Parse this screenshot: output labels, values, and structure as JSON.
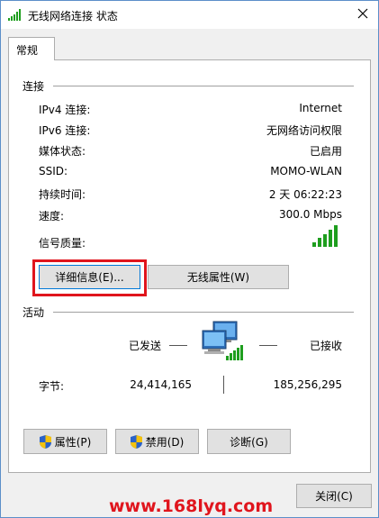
{
  "window": {
    "title": "无线网络连接 状态"
  },
  "tabs": [
    {
      "label": "常规"
    }
  ],
  "connection": {
    "header": "连接",
    "rows": [
      {
        "label": "IPv4 连接:",
        "value": "Internet"
      },
      {
        "label": "IPv6 连接:",
        "value": "无网络访问权限"
      },
      {
        "label": "媒体状态:",
        "value": "已启用"
      },
      {
        "label": "SSID:",
        "value": "MOMO-WLAN"
      },
      {
        "label": "持续时间:",
        "value": "2 天 06:22:23"
      },
      {
        "label": "速度:",
        "value": "300.0 Mbps"
      }
    ],
    "signal_label": "信号质量:",
    "signal_bars_total": 5,
    "signal_bars_filled": 5,
    "details_button": "详细信息(E)...",
    "wireless_props_button": "无线属性(W)"
  },
  "activity": {
    "header": "活动",
    "sent_label": "已发送",
    "received_label": "已接收",
    "bytes_label": "字节:",
    "bytes_sent": "24,414,165",
    "bytes_received": "185,256,295"
  },
  "actions": {
    "properties_button": "属性(P)",
    "disable_button": "禁用(D)",
    "diagnose_button": "诊断(G)"
  },
  "footer": {
    "close_button": "关闭(C)",
    "watermark": "www.168lyq.com"
  },
  "colors": {
    "signal_green": "#1e9e1e",
    "highlight_red": "#e0151d",
    "window_border": "#5c8fc9"
  }
}
